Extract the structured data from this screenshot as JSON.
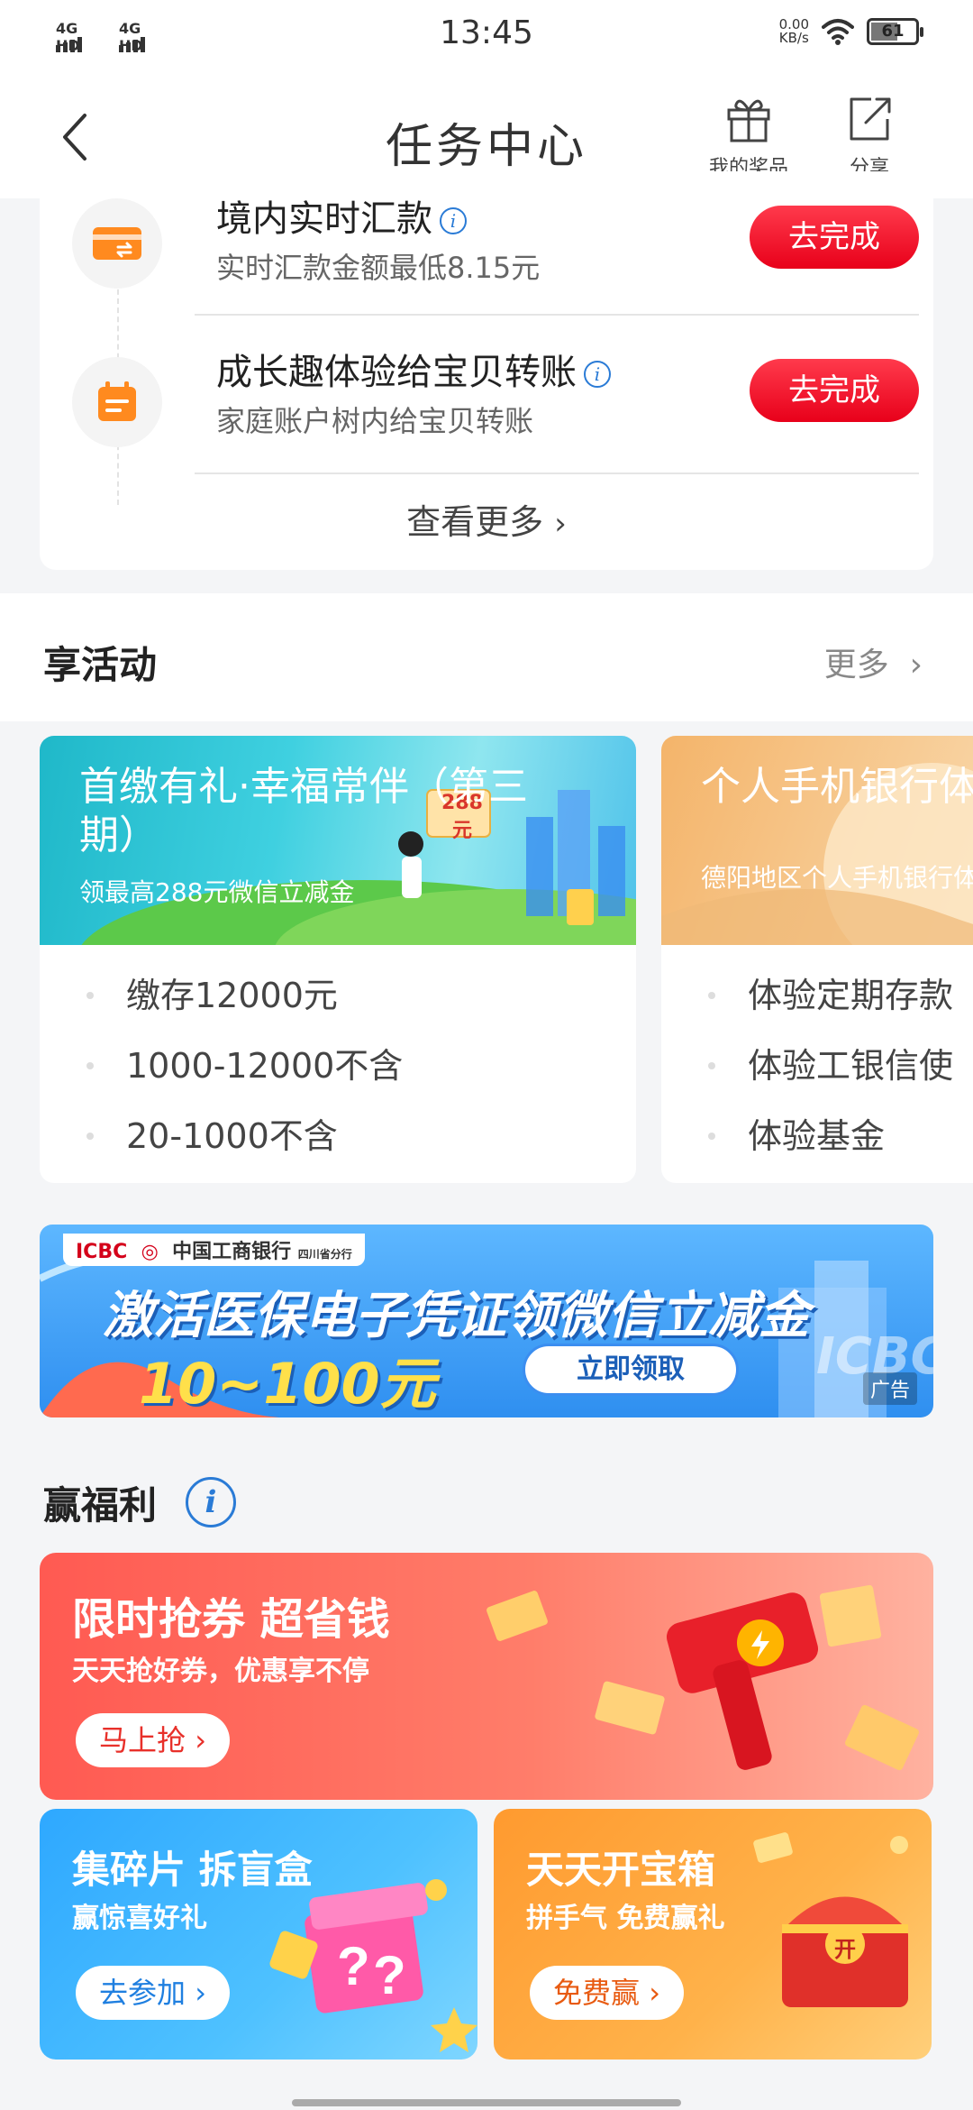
{
  "status_bar": {
    "time": "13:45",
    "sim1": "4G HD",
    "sim2": "4G HD",
    "net_speed_value": "0.00",
    "net_speed_unit": "KB/s",
    "battery": "61",
    "battery_level": 0.61
  },
  "header": {
    "title": "任务中心",
    "my_prizes": "我的奖品",
    "share": "分享"
  },
  "tasks": [
    {
      "title": "境内实时汇款",
      "subtitle": "实时汇款金额最低8.15元",
      "button": "去完成"
    },
    {
      "title": "成长趣体验给宝贝转账",
      "subtitle": "家庭账户树内给宝贝转账",
      "button": "去完成"
    }
  ],
  "see_more": "查看更多",
  "activities_section": {
    "title": "享活动",
    "more": "更多"
  },
  "activities": [
    {
      "title": "首缴有礼·幸福常伴（第三期）",
      "subtitle": "领最高288元微信立减金",
      "badge": "288元",
      "items": [
        "缴存12000元",
        "1000-12000不含",
        "20-1000不含"
      ]
    },
    {
      "title": "个人手机银行体验有礼",
      "subtitle": "德阳地区个人手机银行体验有礼活动",
      "items": [
        "体验定期存款",
        "体验工银信使",
        "体验基金"
      ]
    }
  ],
  "ad_banner": {
    "brand": "ICBC",
    "bank_name": "中国工商银行",
    "branch": "四川省分行",
    "headline": "激活医保电子凭证领微信立减金",
    "amount": "10~100元",
    "button": "立即领取",
    "tag": "广告",
    "watermark": "ICBC"
  },
  "welfare_section": {
    "title": "赢福利"
  },
  "welfare": {
    "coupon": {
      "title": "限时抢券 超省钱",
      "subtitle": "天天抢好券，优惠享不停",
      "button": "马上抢"
    },
    "blind_box": {
      "title": "集碎片 拆盲盒",
      "subtitle": "赢惊喜好礼",
      "button": "去参加"
    },
    "treasure": {
      "title": "天天开宝箱",
      "subtitle": "拼手气 免费赢礼",
      "button": "免费赢",
      "chest_label": "开"
    }
  },
  "colors": {
    "accent_red": "#e8001a",
    "info_blue": "#2a7bd6",
    "task_icon_orange": "#ff8a1f"
  }
}
